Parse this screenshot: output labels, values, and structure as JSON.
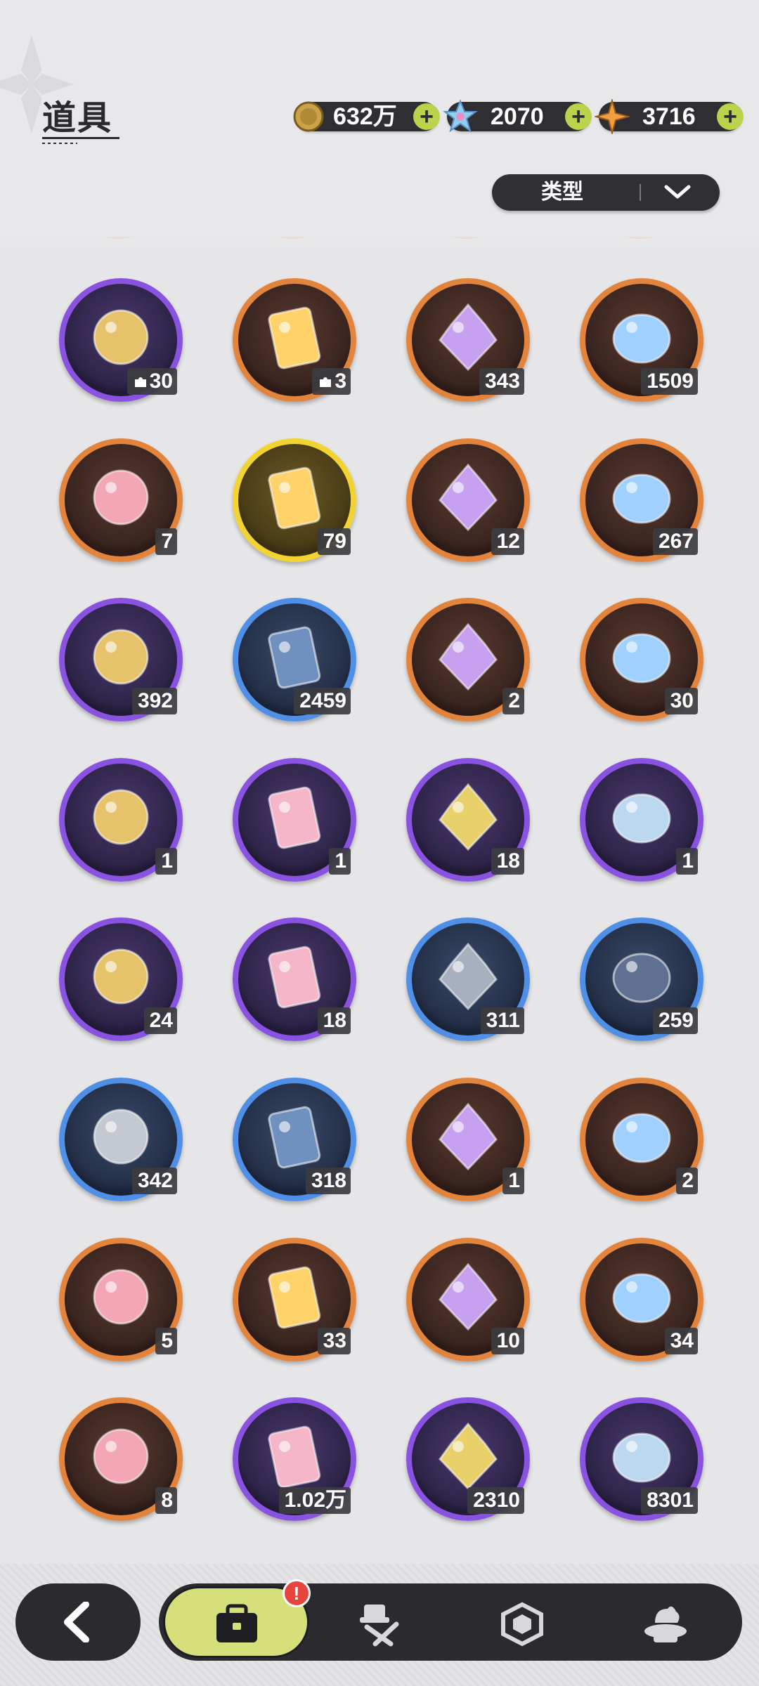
{
  "header": {
    "title": "道具",
    "currencies": [
      {
        "name": "gold-coin",
        "value": "632万",
        "color": "#c9a24a"
      },
      {
        "name": "crystal",
        "value": "2070",
        "color": "#8fd0f0"
      },
      {
        "name": "star-shard",
        "value": "3716",
        "color": "#f0a040"
      }
    ],
    "plus_label": "+",
    "filter": {
      "label": "类型"
    }
  },
  "items": [
    {
      "name": "chick-puzzle-fragment",
      "count": "30",
      "rarity": "purple",
      "fragment": true
    },
    {
      "name": "tiger-puzzle-fragment",
      "count": "3",
      "rarity": "orange",
      "fragment": true
    },
    {
      "name": "pink-crystal",
      "count": "343",
      "rarity": "orange"
    },
    {
      "name": "blue-crystal",
      "count": "1509",
      "rarity": "orange"
    },
    {
      "name": "paw-charm",
      "count": "7",
      "rarity": "orange"
    },
    {
      "name": "gold-character-card",
      "count": "79",
      "rarity": "gold"
    },
    {
      "name": "holo-character-card",
      "count": "12",
      "rarity": "orange"
    },
    {
      "name": "orange-character-card",
      "count": "267",
      "rarity": "orange"
    },
    {
      "name": "purple-character-card",
      "count": "392",
      "rarity": "purple"
    },
    {
      "name": "blue-character-card",
      "count": "2459",
      "rarity": "blue"
    },
    {
      "name": "refresh-card",
      "count": "2",
      "rarity": "orange"
    },
    {
      "name": "clover-ticket",
      "count": "30",
      "rarity": "orange"
    },
    {
      "name": "horned-crown",
      "count": "1",
      "rarity": "purple"
    },
    {
      "name": "gift-box",
      "count": "1",
      "rarity": "purple"
    },
    {
      "name": "golden-egg",
      "count": "18",
      "rarity": "purple"
    },
    {
      "name": "magic-mirror",
      "count": "1",
      "rarity": "purple"
    },
    {
      "name": "scroll",
      "count": "24",
      "rarity": "purple"
    },
    {
      "name": "peach",
      "count": "18",
      "rarity": "purple"
    },
    {
      "name": "shovel",
      "count": "311",
      "rarity": "blue"
    },
    {
      "name": "boxing-glove",
      "count": "259",
      "rarity": "blue"
    },
    {
      "name": "pickaxe",
      "count": "342",
      "rarity": "blue"
    },
    {
      "name": "hammers",
      "count": "318",
      "rarity": "blue"
    },
    {
      "name": "potion",
      "count": "1",
      "rarity": "orange"
    },
    {
      "name": "golden-key",
      "count": "2",
      "rarity": "orange"
    },
    {
      "name": "gem-emblem",
      "count": "5",
      "rarity": "orange"
    },
    {
      "name": "ruby-fruit",
      "count": "33",
      "rarity": "orange"
    },
    {
      "name": "outfit-coin",
      "count": "10",
      "rarity": "orange"
    },
    {
      "name": "wheel-ticket",
      "count": "34",
      "rarity": "orange"
    },
    {
      "name": "rainbow-puzzle-ticket",
      "count": "8",
      "rarity": "orange"
    },
    {
      "name": "star-orb",
      "count": "1.02万",
      "rarity": "purple"
    },
    {
      "name": "fist-medal",
      "count": "2310",
      "rarity": "purple"
    },
    {
      "name": "rune-coin",
      "count": "8301",
      "rarity": "purple"
    }
  ],
  "nav": {
    "tabs": [
      "bag",
      "equipment",
      "gem",
      "dessert"
    ],
    "active": "bag",
    "alert_badge": "!"
  }
}
